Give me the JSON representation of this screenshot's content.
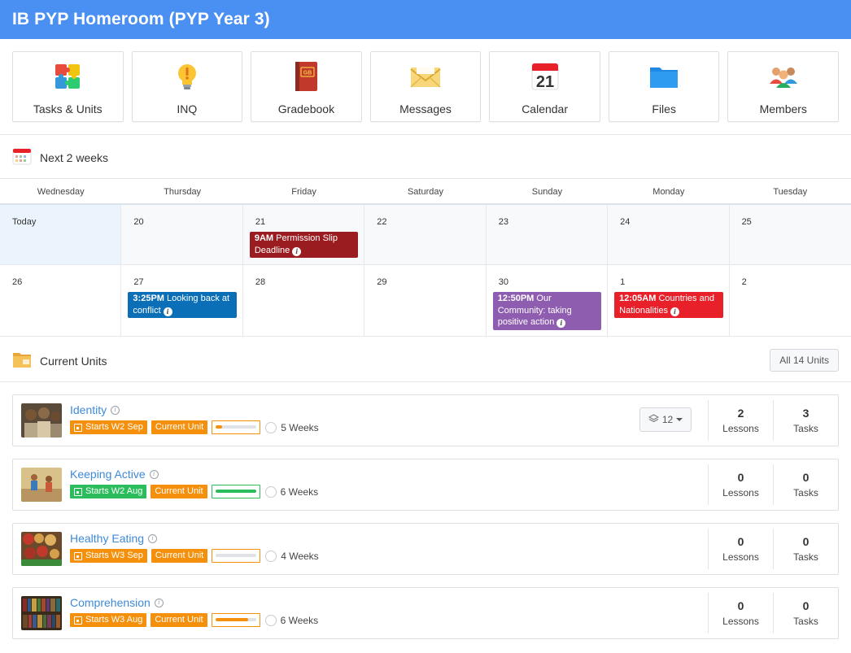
{
  "header": {
    "title": "IB PYP Homeroom (PYP Year 3)"
  },
  "tiles": [
    {
      "label": "Tasks & Units",
      "icon": "puzzle-icon"
    },
    {
      "label": "INQ",
      "icon": "lightbulb-icon"
    },
    {
      "label": "Gradebook",
      "icon": "gradebook-icon",
      "badge": "GB"
    },
    {
      "label": "Messages",
      "icon": "envelope-icon"
    },
    {
      "label": "Calendar",
      "icon": "calendar-icon",
      "day": "21"
    },
    {
      "label": "Files",
      "icon": "folder-icon"
    },
    {
      "label": "Members",
      "icon": "members-icon"
    }
  ],
  "calendar": {
    "heading": "Next 2 weeks",
    "days": [
      "Wednesday",
      "Thursday",
      "Friday",
      "Saturday",
      "Sunday",
      "Monday",
      "Tuesday"
    ],
    "week1": [
      {
        "num": "Today",
        "today": true
      },
      {
        "num": "20"
      },
      {
        "num": "21",
        "event": {
          "time": "9AM",
          "title": "Permission Slip Deadline",
          "color": "#9b1c20"
        }
      },
      {
        "num": "22"
      },
      {
        "num": "23"
      },
      {
        "num": "24"
      },
      {
        "num": "25"
      }
    ],
    "week2": [
      {
        "num": "26"
      },
      {
        "num": "27",
        "event": {
          "time": "3:25PM",
          "title": "Looking back at conflict",
          "color": "#0b6fb8"
        }
      },
      {
        "num": "28"
      },
      {
        "num": "29"
      },
      {
        "num": "30",
        "event": {
          "time": "12:50PM",
          "title": "Our Community: taking positive action",
          "color": "#8e5db0"
        }
      },
      {
        "num": "1",
        "event": {
          "time": "12:05AM",
          "title": "Countries and Nationalities",
          "color": "#e8202a"
        }
      },
      {
        "num": "2"
      }
    ]
  },
  "units": {
    "heading": "Current Units",
    "all_button": "All 14 Units",
    "items": [
      {
        "title": "Identity",
        "starts": "Starts W2 Sep",
        "starts_color": "#f5900c",
        "status": "Current Unit",
        "status_color": "#f5900c",
        "progress": 0.15,
        "progress_color": "#f5900c",
        "weeks": "5 Weeks",
        "lessons": "2",
        "tasks": "3",
        "layers": "12",
        "lessons_label": "Lessons",
        "tasks_label": "Tasks"
      },
      {
        "title": "Keeping Active",
        "starts": "Starts W2 Aug",
        "starts_color": "#2bbd5b",
        "status": "Current Unit",
        "status_color": "#f5900c",
        "progress": 1.0,
        "progress_color": "#2bbd5b",
        "weeks": "6 Weeks",
        "lessons": "0",
        "tasks": "0",
        "lessons_label": "Lessons",
        "tasks_label": "Tasks"
      },
      {
        "title": "Healthy Eating",
        "starts": "Starts W3 Sep",
        "starts_color": "#f5900c",
        "status": "Current Unit",
        "status_color": "#f5900c",
        "progress": 0.0,
        "progress_color": "#f5900c",
        "weeks": "4 Weeks",
        "lessons": "0",
        "tasks": "0",
        "lessons_label": "Lessons",
        "tasks_label": "Tasks"
      },
      {
        "title": "Comprehension",
        "starts": "Starts W3 Aug",
        "starts_color": "#f5900c",
        "status": "Current Unit",
        "status_color": "#f5900c",
        "progress": 0.8,
        "progress_color": "#f5900c",
        "weeks": "6 Weeks",
        "lessons": "0",
        "tasks": "0",
        "lessons_label": "Lessons",
        "tasks_label": "Tasks"
      }
    ]
  }
}
